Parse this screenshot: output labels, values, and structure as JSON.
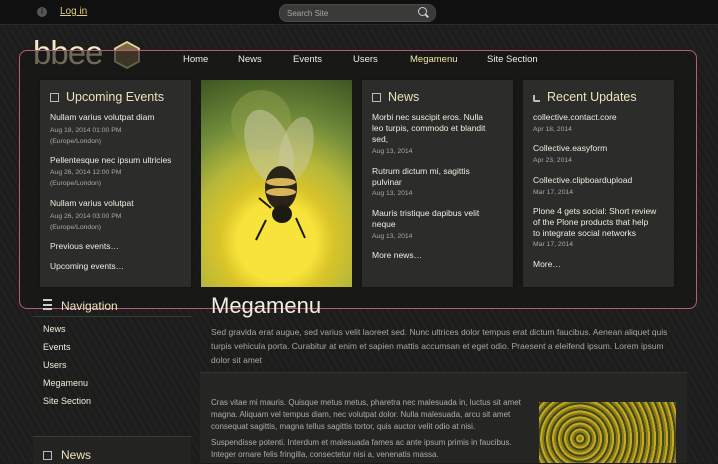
{
  "topbar": {
    "login_label": "Log in",
    "search_placeholder": "Search Site"
  },
  "logo": {
    "text": "bbee"
  },
  "nav": [
    "Home",
    "News",
    "Events",
    "Users",
    "Megamenu",
    "Site Section"
  ],
  "events": {
    "title": "Upcoming Events",
    "items": [
      {
        "title": "Nullam varius volutpat diam",
        "date": "Aug 18, 2014 01:00 PM",
        "tz": "(Europe/London)"
      },
      {
        "title": "Pellentesque nec ipsum ultricies",
        "date": "Aug 26, 2014 12:00 PM",
        "tz": "(Europe/London)"
      },
      {
        "title": "Nullam varius volutpat",
        "date": "Aug 26, 2014 03:00 PM",
        "tz": "(Europe/London)"
      }
    ],
    "previous": "Previous events…",
    "upcoming": "Upcoming events…"
  },
  "news": {
    "title": "News",
    "items": [
      {
        "line1": "Morbi nec suscipit eros. Nulla",
        "line2": "leo turpis, commodo et blandit",
        "line3": "sed,",
        "date": "Aug 13, 2014"
      },
      {
        "line1": "Rutrum dictum mi, sagittis",
        "line2": "pulvinar",
        "date": "Aug 13, 2014"
      },
      {
        "line1": "Mauris tristique dapibus velit",
        "line2": "neque",
        "date": "Aug 13, 2014"
      }
    ],
    "more": "More news…"
  },
  "updates": {
    "title": "Recent Updates",
    "items": [
      {
        "title": "collective.contact.core",
        "date": "Apr 18, 2014"
      },
      {
        "title": "Collective.easyform",
        "date": "Apr 23, 2014"
      },
      {
        "title": "Collective.clipboardupload",
        "date": "Mar 17, 2014"
      },
      {
        "line1": "Plone 4 gets social: Short review",
        "line2": "of the Plone products that help",
        "line3": "to integrate social networks",
        "date": "Mar 17, 2014"
      }
    ],
    "more": "More…"
  },
  "sidebar": {
    "nav_title": "Navigation",
    "items": [
      "News",
      "Events",
      "Users",
      "Megamenu",
      "Site Section"
    ],
    "news_title": "News"
  },
  "main": {
    "title": "Megamenu",
    "lead": "Sed gravida erat augue, sed varius velit laoreet sed. Nunc ultrices dolor tempus erat dictum faucibus. Aenean aliquet quis turpis vehicula porta. Curabitur at enim et sapien mattis accumsan et eget odio. Praesent a eleifend ipsum. Lorem ipsum dolor sit amet",
    "para1": "Cras vitae mi mauris. Quisque metus metus, pharetra nec malesuada in, luctus sit amet magna. Aliquam vel tempus diam, nec volutpat dolor. Nulla malesuada, arcu sit amet consequat sagittis, magna tellus sagittis tortor, quis auctor velit odio at nisi.",
    "para2": "Suspendisse potenti. Interdum et malesuada fames ac ante ipsum primis in faucibus. Integer ornare felis fringilla, consectetur nisi a, venenatis massa."
  },
  "colors": {
    "accent": "#c05878",
    "heading": "#ece4bd"
  }
}
